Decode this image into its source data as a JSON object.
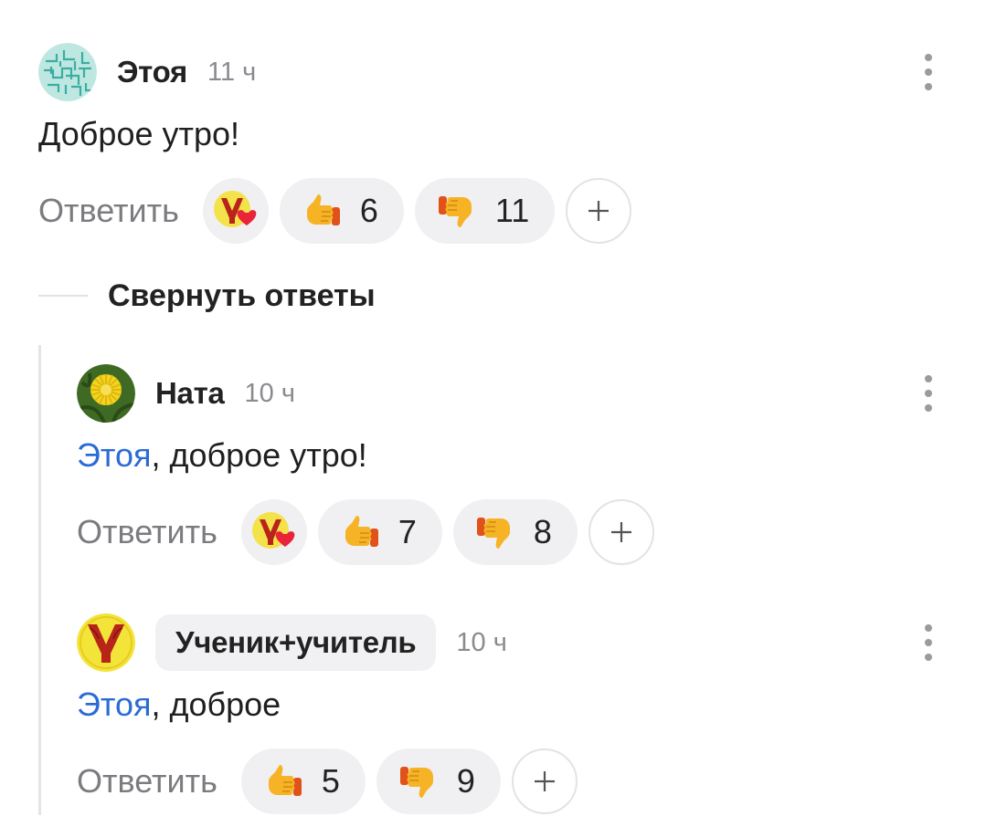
{
  "comments": [
    {
      "author": "Этоя",
      "time": "11 ч",
      "text": "Доброе утро!",
      "reply_label": "Ответить",
      "reactions": {
        "likes": "6",
        "dislikes": "11"
      },
      "has_badge_reaction": true
    },
    {
      "author": "Ната",
      "time": "10 ч",
      "mention": "Этоя",
      "text": ", доброе утро!",
      "reply_label": "Ответить",
      "reactions": {
        "likes": "7",
        "dislikes": "8"
      },
      "has_badge_reaction": true
    },
    {
      "author": "Ученик+учитель",
      "time": "10 ч",
      "mention": "Этоя",
      "text": ", доброе",
      "reply_label": "Ответить",
      "reactions": {
        "likes": "5",
        "dislikes": "9"
      },
      "has_badge_reaction": false
    }
  ],
  "thread": {
    "collapse_label": "Свернуть ответы"
  },
  "colors": {
    "mention": "#2b6bd6",
    "pill_bg": "#f0f0f2",
    "muted": "#7b7b80"
  },
  "icons": [
    "maze-avatar",
    "dandelion-avatar",
    "letter-u-avatar",
    "thumbs-up-icon",
    "thumbs-down-icon",
    "plus-icon",
    "more-vertical-icon",
    "u-heart-reaction-icon"
  ]
}
